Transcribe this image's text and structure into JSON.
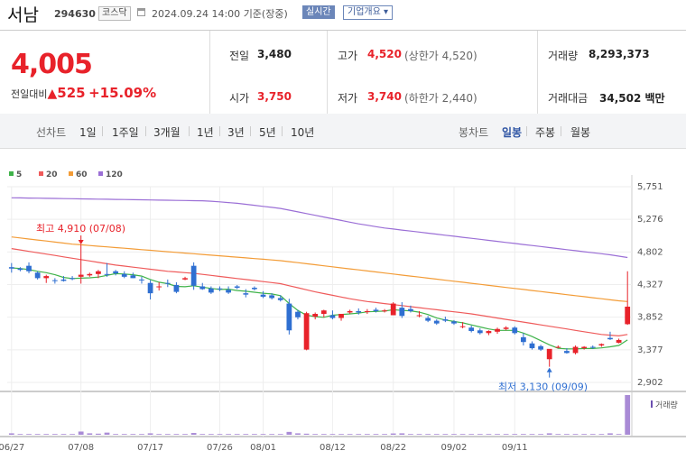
{
  "header": {
    "name": "서남",
    "code": "294630",
    "market": "코스닥",
    "datetime": "2024.09.24 14:00",
    "basis": "기준(장중)",
    "realtime_label": "실시간",
    "overview_label": "기업개요 ▾"
  },
  "quote": {
    "price": "4,005",
    "change_label": "전일대비",
    "change_value": "525",
    "change_pct": "+15.09%",
    "prev_label": "전일",
    "prev_value": "3,480",
    "high_label": "고가",
    "high_value": "4,520",
    "upper_limit": "(상한가 4,520)",
    "volume_label": "거래량",
    "volume_value": "8,293,373",
    "open_label": "시가",
    "open_value": "3,750",
    "low_label": "저가",
    "low_value": "3,740",
    "lower_limit": "(하한가 2,440)",
    "amount_label": "거래대금",
    "amount_value": "34,502 백만"
  },
  "line_tabs": {
    "label": "선차트",
    "items": [
      "1일",
      "1주일",
      "3개월",
      "1년",
      "3년",
      "5년",
      "10년"
    ]
  },
  "candle_tabs": {
    "label": "봉차트",
    "items": [
      "일봉",
      "주봉",
      "월봉"
    ],
    "selected": "일봉"
  },
  "colors": {
    "up": "#e8222a",
    "down": "#2f6fd1",
    "ma5": "#3fb34a",
    "ma20": "#ef5b5b",
    "ma60": "#f39c37",
    "ma120": "#9b6fd6"
  },
  "chart_data": {
    "type": "candlestick",
    "legend": [
      {
        "name": "5",
        "color": "#3fb34a"
      },
      {
        "name": "20",
        "color": "#ef5b5b"
      },
      {
        "name": "60",
        "color": "#f39c37"
      },
      {
        "name": "120",
        "color": "#9b6fd6"
      }
    ],
    "ylim": [
      2902,
      5751
    ],
    "yticks": [
      "5,751",
      "5,276",
      "4,802",
      "4,327",
      "3,852",
      "3,377",
      "2,902"
    ],
    "xticks": [
      "06/27",
      "07/08",
      "07/17",
      "07/26",
      "08/01",
      "08/12",
      "08/22",
      "09/02",
      "09/11"
    ],
    "max_label": "최고 4,910 (07/08)",
    "min_label": "최저 3,130 (09/09)",
    "volume_label": "거래량",
    "candles": [
      [
        4580,
        4640,
        4500,
        4560
      ],
      [
        4560,
        4580,
        4520,
        4540
      ],
      [
        4600,
        4650,
        4490,
        4520
      ],
      [
        4500,
        4520,
        4400,
        4420
      ],
      [
        4420,
        4470,
        4350,
        4450
      ],
      [
        4390,
        4420,
        4340,
        4380
      ],
      [
        4400,
        4450,
        4370,
        4380
      ],
      [
        4420,
        4450,
        4390,
        4410
      ],
      [
        4440,
        4910,
        4340,
        4470
      ],
      [
        4460,
        4500,
        4440,
        4480
      ],
      [
        4480,
        4540,
        4420,
        4520
      ],
      [
        4480,
        4640,
        4440,
        4470
      ],
      [
        4520,
        4540,
        4460,
        4490
      ],
      [
        4480,
        4520,
        4420,
        4440
      ],
      [
        4460,
        4500,
        4420,
        4420
      ],
      [
        4400,
        4440,
        4340,
        4390
      ],
      [
        4350,
        4390,
        4110,
        4200
      ],
      [
        4300,
        4360,
        4240,
        4300
      ],
      [
        4350,
        4400,
        4290,
        4340
      ],
      [
        4320,
        4360,
        4200,
        4220
      ],
      [
        4400,
        4440,
        4390,
        4420
      ],
      [
        4600,
        4650,
        4250,
        4310
      ],
      [
        4300,
        4350,
        4250,
        4260
      ],
      [
        4270,
        4300,
        4190,
        4210
      ],
      [
        4270,
        4300,
        4230,
        4260
      ],
      [
        4250,
        4300,
        4190,
        4210
      ],
      [
        4300,
        4320,
        4260,
        4280
      ],
      [
        4200,
        4260,
        4140,
        4180
      ],
      [
        4280,
        4300,
        4240,
        4260
      ],
      [
        4180,
        4230,
        4130,
        4150
      ],
      [
        4170,
        4200,
        4110,
        4130
      ],
      [
        4130,
        4170,
        4080,
        4100
      ],
      [
        4050,
        4120,
        3600,
        3660
      ],
      [
        3930,
        3960,
        3820,
        3850
      ],
      [
        3380,
        3930,
        3370,
        3910
      ],
      [
        3860,
        3920,
        3820,
        3900
      ],
      [
        3900,
        3960,
        3850,
        3950
      ],
      [
        3880,
        3950,
        3820,
        3840
      ],
      [
        3840,
        3900,
        3800,
        3900
      ],
      [
        3920,
        3960,
        3900,
        3940
      ],
      [
        3940,
        3980,
        3890,
        3920
      ],
      [
        3930,
        3970,
        3900,
        3940
      ],
      [
        3960,
        3990,
        3920,
        3940
      ],
      [
        3940,
        3970,
        3920,
        3950
      ],
      [
        3880,
        4070,
        3880,
        4050
      ],
      [
        3990,
        4070,
        3840,
        3870
      ],
      [
        3970,
        4020,
        3920,
        3940
      ],
      [
        3870,
        3940,
        3850,
        3880
      ],
      [
        3840,
        3870,
        3780,
        3800
      ],
      [
        3800,
        3820,
        3740,
        3760
      ],
      [
        3820,
        3860,
        3780,
        3800
      ],
      [
        3790,
        3810,
        3740,
        3760
      ],
      [
        3720,
        3780,
        3690,
        3720
      ],
      [
        3700,
        3730,
        3630,
        3650
      ],
      [
        3660,
        3690,
        3600,
        3620
      ],
      [
        3620,
        3660,
        3590,
        3650
      ],
      [
        3640,
        3700,
        3610,
        3680
      ],
      [
        3680,
        3720,
        3660,
        3700
      ],
      [
        3700,
        3720,
        3600,
        3620
      ],
      [
        3560,
        3620,
        3440,
        3490
      ],
      [
        3470,
        3500,
        3380,
        3400
      ],
      [
        3430,
        3450,
        3360,
        3380
      ],
      [
        3240,
        3380,
        3130,
        3390
      ],
      [
        3420,
        3440,
        3400,
        3420
      ],
      [
        3360,
        3400,
        3320,
        3330
      ],
      [
        3330,
        3440,
        3310,
        3420
      ],
      [
        3400,
        3430,
        3380,
        3420
      ],
      [
        3420,
        3440,
        3390,
        3410
      ],
      [
        3440,
        3470,
        3420,
        3460
      ],
      [
        3550,
        3640,
        3520,
        3530
      ],
      [
        3480,
        3540,
        3470,
        3520
      ],
      [
        3750,
        4520,
        3740,
        4005
      ]
    ],
    "volume": [
      20,
      10,
      10,
      10,
      10,
      10,
      10,
      10,
      45,
      20,
      15,
      30,
      10,
      10,
      10,
      10,
      20,
      10,
      10,
      10,
      10,
      25,
      10,
      10,
      10,
      10,
      10,
      10,
      10,
      10,
      10,
      10,
      40,
      20,
      15,
      10,
      10,
      10,
      10,
      10,
      10,
      10,
      10,
      10,
      18,
      20,
      10,
      10,
      10,
      10,
      10,
      10,
      10,
      10,
      10,
      10,
      10,
      10,
      10,
      10,
      10,
      10,
      20,
      10,
      10,
      10,
      10,
      10,
      10,
      20,
      10,
      560
    ],
    "ma5": [
      4570,
      4560,
      4545,
      4520,
      4500,
      4470,
      4430,
      4415,
      4420,
      4425,
      4435,
      4460,
      4485,
      4480,
      4470,
      4450,
      4400,
      4360,
      4340,
      4300,
      4295,
      4310,
      4290,
      4270,
      4255,
      4260,
      4240,
      4230,
      4215,
      4200,
      4190,
      4165,
      4050,
      3950,
      3880,
      3860,
      3850,
      3880,
      3890,
      3900,
      3910,
      3930,
      3935,
      3940,
      3960,
      3950,
      3945,
      3925,
      3890,
      3840,
      3810,
      3790,
      3770,
      3740,
      3710,
      3680,
      3660,
      3660,
      3660,
      3620,
      3570,
      3510,
      3450,
      3400,
      3390,
      3390,
      3395,
      3395,
      3405,
      3420,
      3440,
      3520
    ],
    "ma20": [
      4850,
      4830,
      4810,
      4790,
      4770,
      4750,
      4730,
      4710,
      4690,
      4670,
      4650,
      4630,
      4610,
      4595,
      4580,
      4565,
      4550,
      4535,
      4520,
      4510,
      4500,
      4490,
      4475,
      4460,
      4445,
      4430,
      4415,
      4400,
      4385,
      4370,
      4355,
      4340,
      4310,
      4280,
      4250,
      4220,
      4195,
      4170,
      4145,
      4120,
      4100,
      4080,
      4065,
      4050,
      4035,
      4020,
      4005,
      3990,
      3975,
      3960,
      3945,
      3930,
      3915,
      3900,
      3880,
      3860,
      3840,
      3820,
      3800,
      3780,
      3760,
      3740,
      3720,
      3700,
      3680,
      3660,
      3640,
      3620,
      3600,
      3590,
      3580,
      3600
    ],
    "ma60": [
      5020,
      5005,
      4990,
      4975,
      4960,
      4945,
      4930,
      4915,
      4905,
      4895,
      4885,
      4875,
      4865,
      4855,
      4845,
      4835,
      4825,
      4815,
      4805,
      4795,
      4785,
      4775,
      4765,
      4755,
      4745,
      4735,
      4725,
      4715,
      4705,
      4695,
      4685,
      4675,
      4660,
      4645,
      4630,
      4615,
      4600,
      4585,
      4570,
      4555,
      4540,
      4525,
      4510,
      4495,
      4480,
      4465,
      4450,
      4435,
      4420,
      4405,
      4390,
      4375,
      4360,
      4345,
      4330,
      4315,
      4300,
      4285,
      4270,
      4255,
      4240,
      4225,
      4210,
      4195,
      4180,
      4165,
      4150,
      4135,
      4120,
      4105,
      4090,
      4080
    ],
    "ma120": [
      5590,
      5588,
      5586,
      5584,
      5582,
      5580,
      5578,
      5576,
      5574,
      5572,
      5570,
      5568,
      5566,
      5564,
      5562,
      5560,
      5558,
      5556,
      5554,
      5552,
      5550,
      5548,
      5546,
      5540,
      5530,
      5520,
      5510,
      5495,
      5480,
      5465,
      5450,
      5435,
      5410,
      5385,
      5360,
      5335,
      5310,
      5285,
      5260,
      5235,
      5210,
      5190,
      5170,
      5150,
      5135,
      5120,
      5105,
      5090,
      5075,
      5060,
      5045,
      5030,
      5015,
      5000,
      4985,
      4970,
      4955,
      4940,
      4925,
      4910,
      4895,
      4880,
      4865,
      4850,
      4835,
      4820,
      4805,
      4790,
      4775,
      4760,
      4740,
      4720
    ]
  }
}
